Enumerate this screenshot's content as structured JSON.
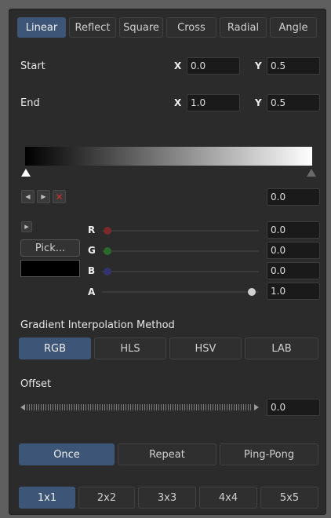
{
  "gradient_type_tabs": [
    {
      "label": "Linear",
      "active": true
    },
    {
      "label": "Reflect",
      "active": false
    },
    {
      "label": "Square",
      "active": false
    },
    {
      "label": "Cross",
      "active": false
    },
    {
      "label": "Radial",
      "active": false
    },
    {
      "label": "Angle",
      "active": false
    }
  ],
  "start": {
    "label": "Start",
    "x_label": "X",
    "x_value": "0.0",
    "y_label": "Y",
    "y_value": "0.5"
  },
  "end": {
    "label": "End",
    "x_label": "X",
    "x_value": "1.0",
    "y_label": "Y",
    "y_value": "0.5"
  },
  "gradient_bar": {
    "start_color": "#000000",
    "end_color": "#ffffff",
    "selected_stop_value": "0.0"
  },
  "color_controls": {
    "pick_label": "Pick...",
    "swatch_color": "#000000",
    "channels": [
      {
        "label": "R",
        "value": "0.0",
        "knob_color": "#7a2a2a"
      },
      {
        "label": "G",
        "value": "0.0",
        "knob_color": "#2a6a2a"
      },
      {
        "label": "B",
        "value": "0.0",
        "knob_color": "#33336e"
      },
      {
        "label": "A",
        "value": "1.0",
        "knob_color": "#d0d0d0"
      }
    ]
  },
  "interpolation": {
    "heading": "Gradient Interpolation Method",
    "options": [
      {
        "label": "RGB",
        "active": true
      },
      {
        "label": "HLS",
        "active": false
      },
      {
        "label": "HSV",
        "active": false
      },
      {
        "label": "LAB",
        "active": false
      }
    ]
  },
  "offset": {
    "label": "Offset",
    "value": "0.0"
  },
  "repeat_modes": [
    {
      "label": "Once",
      "active": true
    },
    {
      "label": "Repeat",
      "active": false
    },
    {
      "label": "Ping-Pong",
      "active": false
    }
  ],
  "sampling": [
    {
      "label": "1x1",
      "active": true
    },
    {
      "label": "2x2",
      "active": false
    },
    {
      "label": "3x3",
      "active": false
    },
    {
      "label": "4x4",
      "active": false
    },
    {
      "label": "5x5",
      "active": false
    }
  ],
  "colors": {
    "accent": "#3d5576",
    "panel": "#2b2b2b",
    "field": "#1a1a1a"
  }
}
